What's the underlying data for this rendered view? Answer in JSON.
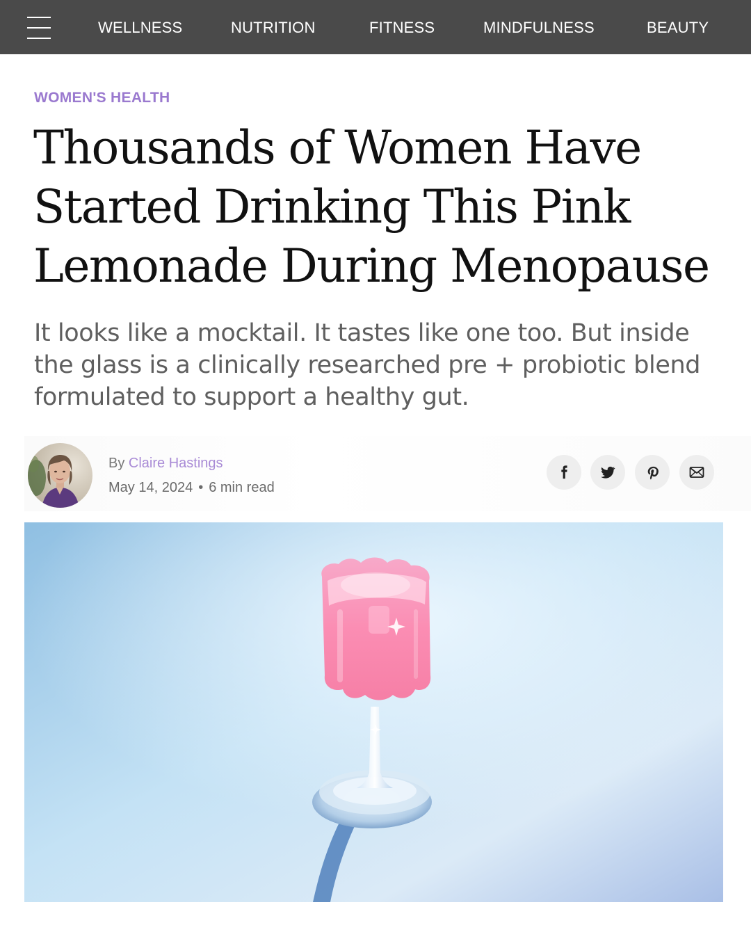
{
  "nav": {
    "menu_icon": "hamburger-menu-icon",
    "background": "#4a4a4a",
    "links": [
      "WELLNESS",
      "NUTRITION",
      "FITNESS",
      "MINDFULNESS",
      "BEAUTY"
    ]
  },
  "article": {
    "category": "WOMEN'S HEALTH",
    "category_color": "#9a79cf",
    "headline": "Thousands of Women Have Started Drinking This Pink Lemonade During Menopause",
    "dek": "It looks like a mocktail. It tastes like one too. But inside the glass is a clinically researched pre + probiotic blend formulated to support a healthy gut."
  },
  "byline": {
    "by": "By",
    "author": "Claire Hastings",
    "date": "May 14, 2024",
    "separator": "•",
    "read_time": "6 min read"
  },
  "share": {
    "icons": [
      "facebook-icon",
      "twitter-icon",
      "pinterest-icon",
      "email-icon"
    ]
  },
  "hero": {
    "subject": "pink lemonade in wavy stemmed glass"
  }
}
